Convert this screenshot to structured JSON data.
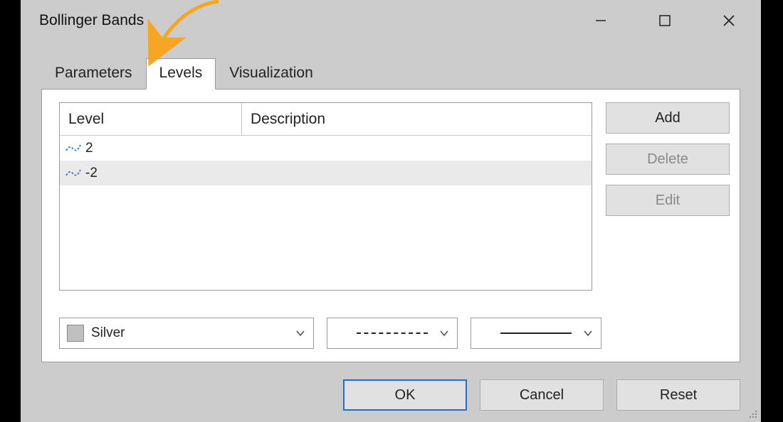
{
  "window": {
    "title": "Bollinger Bands"
  },
  "tabs": {
    "parameters": "Parameters",
    "levels": "Levels",
    "visualization": "Visualization",
    "active": "levels"
  },
  "table": {
    "headers": {
      "level": "Level",
      "description": "Description"
    },
    "rows": [
      {
        "level": "2",
        "description": ""
      },
      {
        "level": "-2",
        "description": ""
      }
    ]
  },
  "side_buttons": {
    "add": {
      "label": "Add",
      "enabled": true
    },
    "delete": {
      "label": "Delete",
      "enabled": false
    },
    "edit": {
      "label": "Edit",
      "enabled": false
    }
  },
  "style_controls": {
    "color": {
      "name": "Silver",
      "swatch": "#c0c0c0"
    },
    "line_style": "dashed",
    "line_width": "solid-1"
  },
  "footer": {
    "ok": "OK",
    "cancel": "Cancel",
    "reset": "Reset"
  },
  "annotation": {
    "arrow_color": "#f5a623",
    "points_to": "tab-levels"
  }
}
